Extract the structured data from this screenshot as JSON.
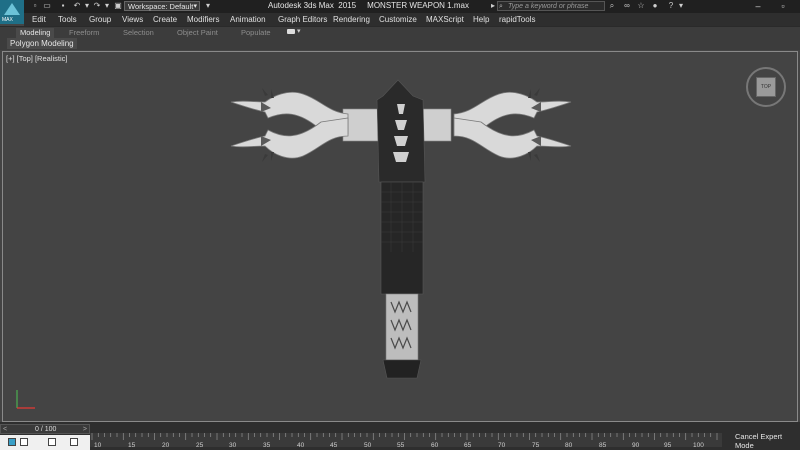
{
  "app": {
    "logo_label": "MAX",
    "title": "Autodesk 3ds Max  2015     MONSTER WEAPON 1.max",
    "workspace": "Workspace: Default",
    "search_placeholder": "Type a keyword or phrase"
  },
  "menu": [
    "Edit",
    "Tools",
    "Group",
    "Views",
    "Create",
    "Modifiers",
    "Animation",
    "Graph Editors",
    "Rendering",
    "Customize",
    "MAXScript",
    "Help",
    "rapidTools"
  ],
  "ribbon": {
    "tabs": [
      "Modeling",
      "Freeform",
      "Selection",
      "Object Paint",
      "Populate"
    ],
    "active_tab": "Modeling",
    "sub_label": "Polygon Modeling"
  },
  "viewport": {
    "label": "[+] [Top] [Realistic]",
    "viewcube_face": "TOP"
  },
  "timeline": {
    "frame_display": "0 / 100",
    "prev_arrow": "<",
    "next_arrow": ">",
    "tick_labels": [
      "10",
      "15",
      "20",
      "25",
      "30",
      "35",
      "40",
      "45",
      "50",
      "55",
      "60",
      "65",
      "70",
      "75",
      "80",
      "85",
      "90",
      "95",
      "100"
    ]
  },
  "status": {
    "expert_label": "Cancel Expert Mode"
  },
  "icons": {
    "new": "new-icon",
    "open": "open-icon",
    "save": "save-icon",
    "undo": "undo-icon",
    "redo": "redo-icon",
    "search": "search-icon",
    "binoculars": "binoculars-icon",
    "star": "star-icon",
    "user": "user-icon",
    "help": "help-icon"
  }
}
